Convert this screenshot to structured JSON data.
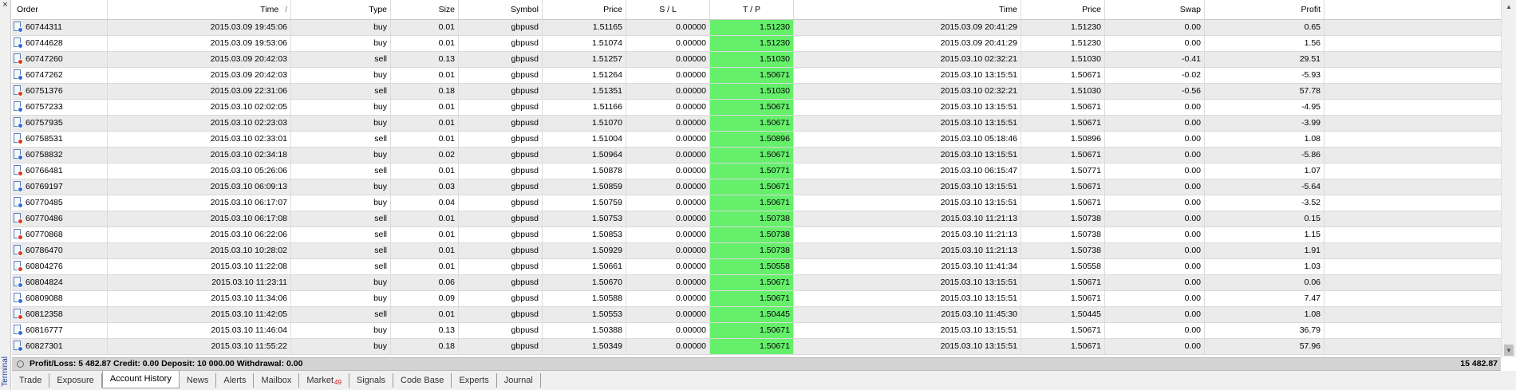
{
  "panel": {
    "side_label": "Terminal",
    "close_glyph": "×"
  },
  "columns": [
    {
      "key": "order",
      "label": "Order",
      "width": 120
    },
    {
      "key": "open_time",
      "label": "Time",
      "width": 230
    },
    {
      "key": "type",
      "label": "Type",
      "width": 125
    },
    {
      "key": "size",
      "label": "Size",
      "width": 85
    },
    {
      "key": "symbol",
      "label": "Symbol",
      "width": 105
    },
    {
      "key": "open_price",
      "label": "Price",
      "width": 105
    },
    {
      "key": "sl",
      "label": "S / L",
      "width": 105
    },
    {
      "key": "tp",
      "label": "T / P",
      "width": 105
    },
    {
      "key": "close_time",
      "label": "Time",
      "width": 285
    },
    {
      "key": "close_price",
      "label": "Price",
      "width": 105
    },
    {
      "key": "swap",
      "label": "Swap",
      "width": 125
    },
    {
      "key": "profit",
      "label": "Profit",
      "width": 150
    }
  ],
  "sort_glyph": "/",
  "rows": [
    {
      "order": "60744311",
      "open_time": "2015.03.09 19:45:06",
      "type": "buy",
      "size": "0.01",
      "symbol": "gbpusd",
      "open_price": "1.51165",
      "sl": "0.00000",
      "tp": "1.51230",
      "close_time": "2015.03.09 20:41:29",
      "close_price": "1.51230",
      "swap": "0.00",
      "profit": "0.65"
    },
    {
      "order": "60744628",
      "open_time": "2015.03.09 19:53:06",
      "type": "buy",
      "size": "0.01",
      "symbol": "gbpusd",
      "open_price": "1.51074",
      "sl": "0.00000",
      "tp": "1.51230",
      "close_time": "2015.03.09 20:41:29",
      "close_price": "1.51230",
      "swap": "0.00",
      "profit": "1.56"
    },
    {
      "order": "60747260",
      "open_time": "2015.03.09 20:42:03",
      "type": "sell",
      "size": "0.13",
      "symbol": "gbpusd",
      "open_price": "1.51257",
      "sl": "0.00000",
      "tp": "1.51030",
      "close_time": "2015.03.10 02:32:21",
      "close_price": "1.51030",
      "swap": "-0.41",
      "profit": "29.51"
    },
    {
      "order": "60747262",
      "open_time": "2015.03.09 20:42:03",
      "type": "buy",
      "size": "0.01",
      "symbol": "gbpusd",
      "open_price": "1.51264",
      "sl": "0.00000",
      "tp": "1.50671",
      "close_time": "2015.03.10 13:15:51",
      "close_price": "1.50671",
      "swap": "-0.02",
      "profit": "-5.93"
    },
    {
      "order": "60751376",
      "open_time": "2015.03.09 22:31:06",
      "type": "sell",
      "size": "0.18",
      "symbol": "gbpusd",
      "open_price": "1.51351",
      "sl": "0.00000",
      "tp": "1.51030",
      "close_time": "2015.03.10 02:32:21",
      "close_price": "1.51030",
      "swap": "-0.56",
      "profit": "57.78"
    },
    {
      "order": "60757233",
      "open_time": "2015.03.10 02:02:05",
      "type": "buy",
      "size": "0.01",
      "symbol": "gbpusd",
      "open_price": "1.51166",
      "sl": "0.00000",
      "tp": "1.50671",
      "close_time": "2015.03.10 13:15:51",
      "close_price": "1.50671",
      "swap": "0.00",
      "profit": "-4.95"
    },
    {
      "order": "60757935",
      "open_time": "2015.03.10 02:23:03",
      "type": "buy",
      "size": "0.01",
      "symbol": "gbpusd",
      "open_price": "1.51070",
      "sl": "0.00000",
      "tp": "1.50671",
      "close_time": "2015.03.10 13:15:51",
      "close_price": "1.50671",
      "swap": "0.00",
      "profit": "-3.99"
    },
    {
      "order": "60758531",
      "open_time": "2015.03.10 02:33:01",
      "type": "sell",
      "size": "0.01",
      "symbol": "gbpusd",
      "open_price": "1.51004",
      "sl": "0.00000",
      "tp": "1.50896",
      "close_time": "2015.03.10 05:18:46",
      "close_price": "1.50896",
      "swap": "0.00",
      "profit": "1.08"
    },
    {
      "order": "60758832",
      "open_time": "2015.03.10 02:34:18",
      "type": "buy",
      "size": "0.02",
      "symbol": "gbpusd",
      "open_price": "1.50964",
      "sl": "0.00000",
      "tp": "1.50671",
      "close_time": "2015.03.10 13:15:51",
      "close_price": "1.50671",
      "swap": "0.00",
      "profit": "-5.86"
    },
    {
      "order": "60766481",
      "open_time": "2015.03.10 05:26:06",
      "type": "sell",
      "size": "0.01",
      "symbol": "gbpusd",
      "open_price": "1.50878",
      "sl": "0.00000",
      "tp": "1.50771",
      "close_time": "2015.03.10 06:15:47",
      "close_price": "1.50771",
      "swap": "0.00",
      "profit": "1.07"
    },
    {
      "order": "60769197",
      "open_time": "2015.03.10 06:09:13",
      "type": "buy",
      "size": "0.03",
      "symbol": "gbpusd",
      "open_price": "1.50859",
      "sl": "0.00000",
      "tp": "1.50671",
      "close_time": "2015.03.10 13:15:51",
      "close_price": "1.50671",
      "swap": "0.00",
      "profit": "-5.64"
    },
    {
      "order": "60770485",
      "open_time": "2015.03.10 06:17:07",
      "type": "buy",
      "size": "0.04",
      "symbol": "gbpusd",
      "open_price": "1.50759",
      "sl": "0.00000",
      "tp": "1.50671",
      "close_time": "2015.03.10 13:15:51",
      "close_price": "1.50671",
      "swap": "0.00",
      "profit": "-3.52"
    },
    {
      "order": "60770486",
      "open_time": "2015.03.10 06:17:08",
      "type": "sell",
      "size": "0.01",
      "symbol": "gbpusd",
      "open_price": "1.50753",
      "sl": "0.00000",
      "tp": "1.50738",
      "close_time": "2015.03.10 11:21:13",
      "close_price": "1.50738",
      "swap": "0.00",
      "profit": "0.15"
    },
    {
      "order": "60770868",
      "open_time": "2015.03.10 06:22:06",
      "type": "sell",
      "size": "0.01",
      "symbol": "gbpusd",
      "open_price": "1.50853",
      "sl": "0.00000",
      "tp": "1.50738",
      "close_time": "2015.03.10 11:21:13",
      "close_price": "1.50738",
      "swap": "0.00",
      "profit": "1.15"
    },
    {
      "order": "60786470",
      "open_time": "2015.03.10 10:28:02",
      "type": "sell",
      "size": "0.01",
      "symbol": "gbpusd",
      "open_price": "1.50929",
      "sl": "0.00000",
      "tp": "1.50738",
      "close_time": "2015.03.10 11:21:13",
      "close_price": "1.50738",
      "swap": "0.00",
      "profit": "1.91"
    },
    {
      "order": "60804276",
      "open_time": "2015.03.10 11:22:08",
      "type": "sell",
      "size": "0.01",
      "symbol": "gbpusd",
      "open_price": "1.50661",
      "sl": "0.00000",
      "tp": "1.50558",
      "close_time": "2015.03.10 11:41:34",
      "close_price": "1.50558",
      "swap": "0.00",
      "profit": "1.03"
    },
    {
      "order": "60804824",
      "open_time": "2015.03.10 11:23:11",
      "type": "buy",
      "size": "0.06",
      "symbol": "gbpusd",
      "open_price": "1.50670",
      "sl": "0.00000",
      "tp": "1.50671",
      "close_time": "2015.03.10 13:15:51",
      "close_price": "1.50671",
      "swap": "0.00",
      "profit": "0.06"
    },
    {
      "order": "60809088",
      "open_time": "2015.03.10 11:34:06",
      "type": "buy",
      "size": "0.09",
      "symbol": "gbpusd",
      "open_price": "1.50588",
      "sl": "0.00000",
      "tp": "1.50671",
      "close_time": "2015.03.10 13:15:51",
      "close_price": "1.50671",
      "swap": "0.00",
      "profit": "7.47"
    },
    {
      "order": "60812358",
      "open_time": "2015.03.10 11:42:05",
      "type": "sell",
      "size": "0.01",
      "symbol": "gbpusd",
      "open_price": "1.50553",
      "sl": "0.00000",
      "tp": "1.50445",
      "close_time": "2015.03.10 11:45:30",
      "close_price": "1.50445",
      "swap": "0.00",
      "profit": "1.08"
    },
    {
      "order": "60816777",
      "open_time": "2015.03.10 11:46:04",
      "type": "buy",
      "size": "0.13",
      "symbol": "gbpusd",
      "open_price": "1.50388",
      "sl": "0.00000",
      "tp": "1.50671",
      "close_time": "2015.03.10 13:15:51",
      "close_price": "1.50671",
      "swap": "0.00",
      "profit": "36.79"
    },
    {
      "order": "60827301",
      "open_time": "2015.03.10 11:55:22",
      "type": "buy",
      "size": "0.18",
      "symbol": "gbpusd",
      "open_price": "1.50349",
      "sl": "0.00000",
      "tp": "1.50671",
      "close_time": "2015.03.10 13:15:51",
      "close_price": "1.50671",
      "swap": "0.00",
      "profit": "57.96"
    }
  ],
  "summary": {
    "text": "Profit/Loss: 5 482.87   Credit: 0.00   Deposit: 10 000.00   Withdrawal: 0.00",
    "total": "15 482.87"
  },
  "tabs": [
    {
      "label": "Trade",
      "active": false
    },
    {
      "label": "Exposure",
      "active": false
    },
    {
      "label": "Account History",
      "active": true
    },
    {
      "label": "News",
      "active": false
    },
    {
      "label": "Alerts",
      "active": false
    },
    {
      "label": "Mailbox",
      "active": false
    },
    {
      "label": "Market",
      "badge": "49",
      "active": false
    },
    {
      "label": "Signals",
      "active": false
    },
    {
      "label": "Code Base",
      "active": false
    },
    {
      "label": "Experts",
      "active": false
    },
    {
      "label": "Journal",
      "active": false
    }
  ],
  "colors": {
    "tp_highlight": "#65ef6b",
    "summary_bg": "#d3d3d3",
    "buy_dot": "#2f6fd6",
    "sell_dot": "#d83a1f"
  },
  "icons": {
    "buy_order": "order-buy-icon",
    "sell_order": "order-sell-icon"
  }
}
